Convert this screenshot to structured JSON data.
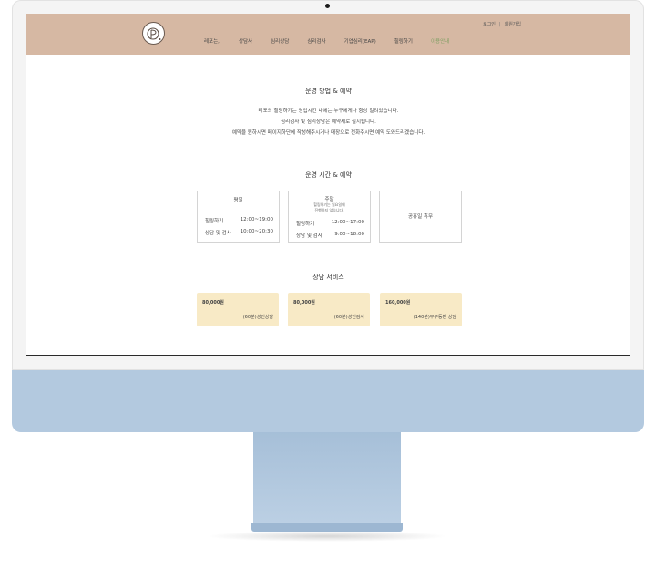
{
  "header": {
    "auth": {
      "login": "로그인",
      "signup": "회원가입"
    },
    "nav": [
      {
        "label": "레포는,"
      },
      {
        "label": "상담사"
      },
      {
        "label": "심리상담"
      },
      {
        "label": "심리검사"
      },
      {
        "label": "기업심리(EAP)"
      },
      {
        "label": "힐링하기"
      },
      {
        "label": "이용안내",
        "active": true
      }
    ]
  },
  "operation": {
    "title": "운영 방법 & 예약",
    "lines": [
      "레포의 힐링하기는 영업시간 내에는 누구에게나 항상 열려있습니다.",
      "심리검사 및 심리상담은 예약제로 실시됩니다.",
      "예약을 원하시면 페이지하단에 작성해주시거나 매장으로 전화주시면 예약 도와드리겠습니다."
    ]
  },
  "hours": {
    "title": "운영 시간 & 예약",
    "weekday": {
      "title": "평일",
      "rows": [
        {
          "label": "힐링하기",
          "time": "12:00~19:00"
        },
        {
          "label": "상담 및 검사",
          "time": "10:00~20:30"
        }
      ]
    },
    "weekend": {
      "title": "주말",
      "note_line1": "힐링하기는 일요일에",
      "note_line2": "진행하지 않습니다.",
      "rows": [
        {
          "label": "힐링하기",
          "time": "12:00~17:00"
        },
        {
          "label": "상담 및 검사",
          "time": "9:00~18:00"
        }
      ]
    },
    "holiday": {
      "title": "공휴일 휴무"
    }
  },
  "services": {
    "title": "상담 서비스",
    "cards": [
      {
        "price": "80,000원",
        "desc": "(60분)성인상담"
      },
      {
        "price": "80,000원",
        "desc": "(60분)성인검사"
      },
      {
        "price": "160,000원",
        "desc": "(140분)부부동반 상담"
      }
    ]
  },
  "colors": {
    "header_bg": "#d6b8a3",
    "active_nav": "#7e9f62",
    "card_bg": "#f8eac6",
    "monitor_chin": "#b3c9df"
  }
}
